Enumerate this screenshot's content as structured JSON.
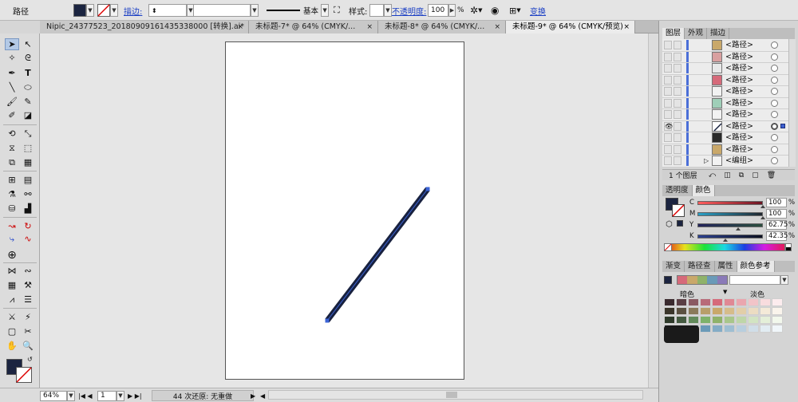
{
  "control_bar": {
    "path_label": "路径",
    "stroke_link": "描边:",
    "stroke_profile": "基本",
    "style_label": "样式:",
    "opacity_link": "不透明度:",
    "opacity_value": "100",
    "opacity_unit": "%",
    "transform_link": "变换",
    "fill_color": "#1b2440"
  },
  "tabs": [
    {
      "label": "Nipic_24377523_20180909161435338000 [转换].ai*",
      "active": false
    },
    {
      "label": "未标题-7* @ 64% (CMYK/...",
      "active": false
    },
    {
      "label": "未标题-8* @ 64% (CMYK/...",
      "active": false
    },
    {
      "label": "未标题-9* @ 64% (CMYK/预览)",
      "active": true
    }
  ],
  "canvas": {
    "stroke_color": "#18213f"
  },
  "status_bar": {
    "zoom": "64%",
    "page": "1",
    "undo_text": "44 次还原: 无重做"
  },
  "layers_panel": {
    "tabs": [
      "图层",
      "外观",
      "描边"
    ],
    "rows": [
      {
        "name": "<路径>",
        "visible": false,
        "selected": false
      },
      {
        "name": "<路径>",
        "visible": false,
        "selected": false
      },
      {
        "name": "<路径>",
        "visible": false,
        "selected": false
      },
      {
        "name": "<路径>",
        "visible": false,
        "selected": false
      },
      {
        "name": "<路径>",
        "visible": false,
        "selected": false
      },
      {
        "name": "<路径>",
        "visible": false,
        "selected": false
      },
      {
        "name": "<路径>",
        "visible": false,
        "selected": false
      },
      {
        "name": "<路径>",
        "visible": true,
        "selected": true
      },
      {
        "name": "<路径>",
        "visible": false,
        "selected": false
      },
      {
        "name": "<路径>",
        "visible": false,
        "selected": false
      },
      {
        "name": "<编组>",
        "visible": false,
        "selected": false
      }
    ],
    "footer_count": "1 个图层"
  },
  "color_panel": {
    "tabs": [
      "透明度",
      "颜色"
    ],
    "sliders": [
      {
        "label": "C",
        "value": "100",
        "fraction": 1.0
      },
      {
        "label": "M",
        "value": "100",
        "fraction": 1.0
      },
      {
        "label": "Y",
        "value": "62.75",
        "fraction": 0.6275
      },
      {
        "label": "K",
        "value": "42.35",
        "fraction": 0.4235
      }
    ],
    "unit": "%"
  },
  "guide_panel": {
    "tabs": [
      "渐变",
      "路径查",
      "属性",
      "颜色参考"
    ],
    "dark_label": "暗色",
    "light_label": "淡色"
  }
}
